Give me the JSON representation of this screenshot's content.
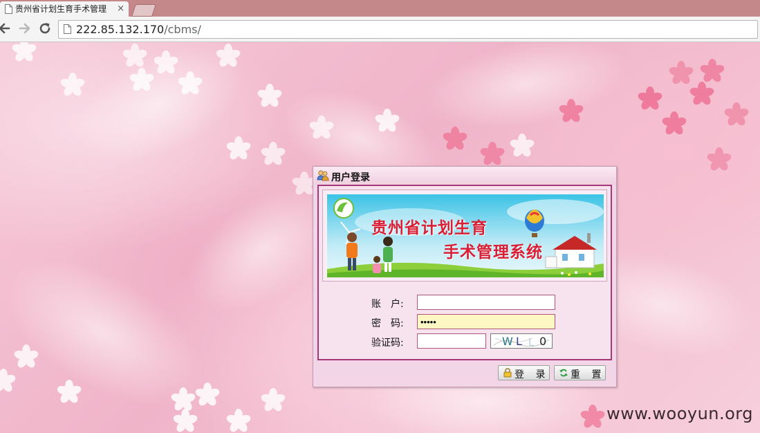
{
  "browser": {
    "tab_title": "贵州省计划生育手术管理",
    "tab_close": "×",
    "address_host": "222.85.132.170",
    "address_path": "/cbms/"
  },
  "dialog": {
    "title": "用户登录",
    "banner": {
      "line1": "贵州省计划生育",
      "line2": "手术管理系统"
    },
    "fields": {
      "account_label": "账　户:",
      "account_value": "",
      "password_label": "密　码:",
      "password_value": "•••••",
      "captcha_label": "验证码:",
      "captcha_value": "",
      "captcha_image_text": "WL0"
    },
    "buttons": {
      "login": "登 录",
      "reset": "重 置"
    }
  },
  "watermark": "www.wooyun.org",
  "colors": {
    "tabbar": "#c4878a",
    "dialog_border": "#a8377a",
    "banner_text": "#d81f35",
    "password_bg": "#fdf7c3"
  }
}
